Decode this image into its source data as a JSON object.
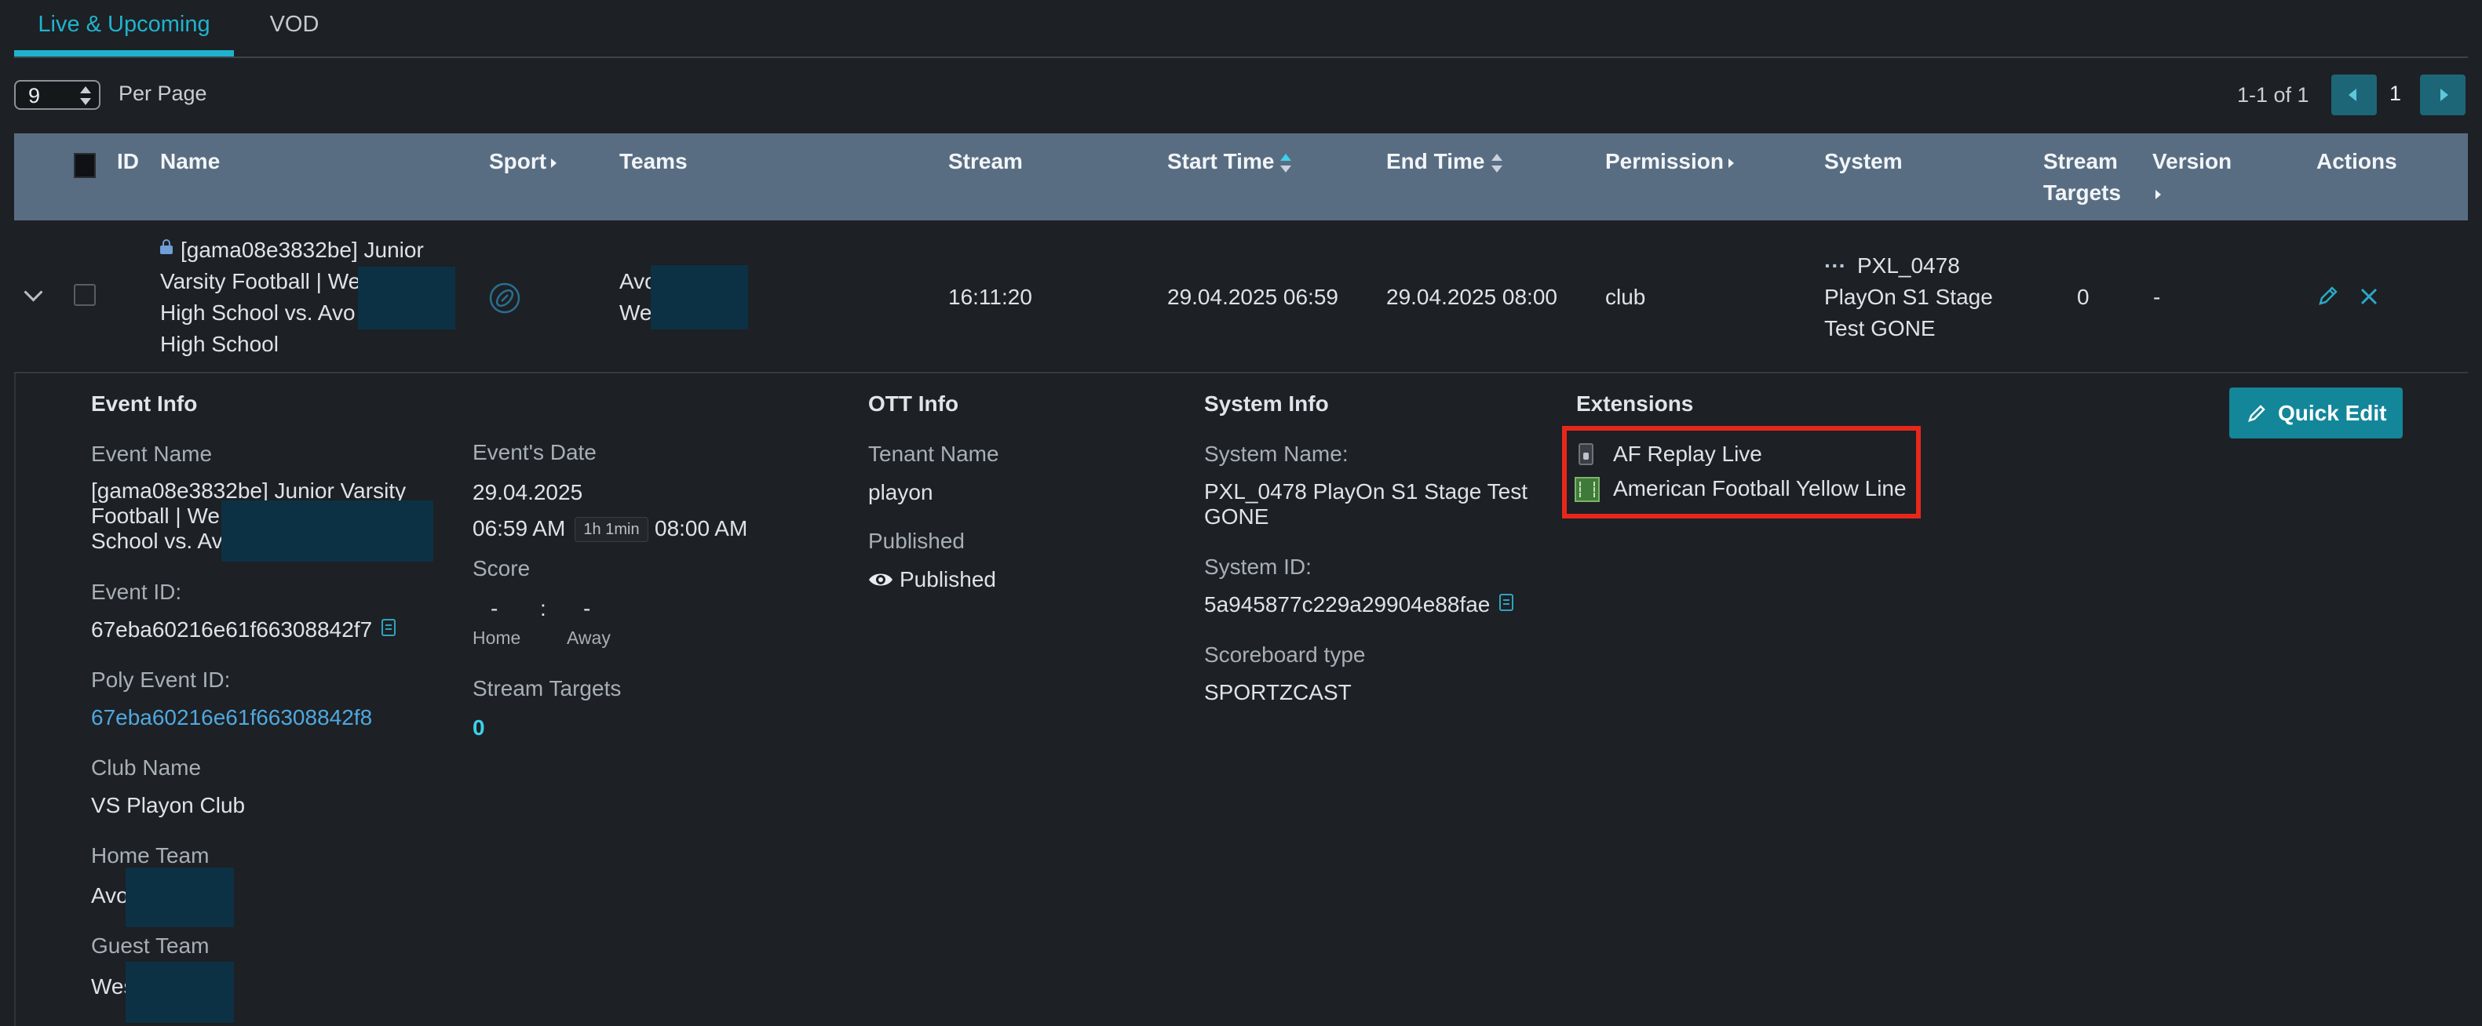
{
  "tabs": [
    {
      "label": "Live & Upcoming",
      "active": true
    },
    {
      "label": "VOD",
      "active": false
    }
  ],
  "pagination": {
    "per_page_value": "9",
    "per_page_label": "Per Page",
    "info": "1-1 of 1",
    "current_page": "1"
  },
  "table": {
    "headers": {
      "id": "ID",
      "name": "Name",
      "sport": "Sport",
      "teams": "Teams",
      "stream": "Stream",
      "start_time": "Start Time",
      "end_time": "End Time",
      "permission": "Permission",
      "system": "System",
      "stream_targets_1": "Stream",
      "stream_targets_2": "Targets",
      "version": "Version",
      "actions": "Actions"
    },
    "row": {
      "name_lines": [
        "[gama08e3832be] Junior",
        "Varsity Football | We",
        "High School vs. Avo",
        "High School"
      ],
      "teams_lines": [
        "Avo",
        "We"
      ],
      "stream": "16:11:20",
      "start_time": "29.04.2025 06:59",
      "end_time": "29.04.2025 08:00",
      "permission": "club",
      "system_lines": [
        "PXL_0478",
        "PlayOn S1 Stage",
        "Test GONE"
      ],
      "system_prefix": "···",
      "stream_targets": "0",
      "version": "-"
    }
  },
  "detail": {
    "event_info": {
      "title": "Event Info",
      "event_name_label": "Event Name",
      "event_name_lines": [
        "[gama08e3832be] Junior Varsity",
        "Football | We",
        "School vs. Av"
      ],
      "event_id_label": "Event ID:",
      "event_id": "67eba60216e61f66308842f7",
      "poly_event_id_label": "Poly Event ID:",
      "poly_event_id": "67eba60216e61f66308842f8",
      "club_name_label": "Club Name",
      "club_name": "VS Playon Club",
      "home_team_label": "Home Team",
      "home_team": "Avo",
      "guest_team_label": "Guest Team",
      "guest_team": "Wes"
    },
    "event_date": {
      "label": "Event's Date",
      "date": "29.04.2025",
      "start": "06:59 AM",
      "duration": "1h 1min",
      "end": "08:00 AM",
      "score_label": "Score",
      "home_score": "-",
      "separator": ":",
      "away_score": "-",
      "home_label": "Home",
      "away_label": "Away",
      "stream_targets_label": "Stream Targets",
      "stream_targets": "0"
    },
    "ott_info": {
      "title": "OTT Info",
      "tenant_label": "Tenant Name",
      "tenant": "playon",
      "published_label": "Published",
      "published": "Published"
    },
    "system_info": {
      "title": "System Info",
      "system_name_label": "System Name:",
      "system_name_lines": [
        "PXL_0478 PlayOn S1 Stage Test",
        "GONE"
      ],
      "system_id_label": "System ID:",
      "system_id": "5a945877c229a29904e88fae",
      "scoreboard_label": "Scoreboard type",
      "scoreboard": "SPORTZCAST"
    },
    "extensions": {
      "title": "Extensions",
      "items": [
        {
          "label": "AF Replay Live",
          "icon": "phone-icon"
        },
        {
          "label": "American Football Yellow Line",
          "icon": "field-icon"
        }
      ]
    },
    "quick_edit_label": "Quick Edit"
  },
  "colors": {
    "accent": "#1fb3cf",
    "header_bg": "#596d82",
    "button_bg": "#138699",
    "highlight": "#e8271c"
  }
}
